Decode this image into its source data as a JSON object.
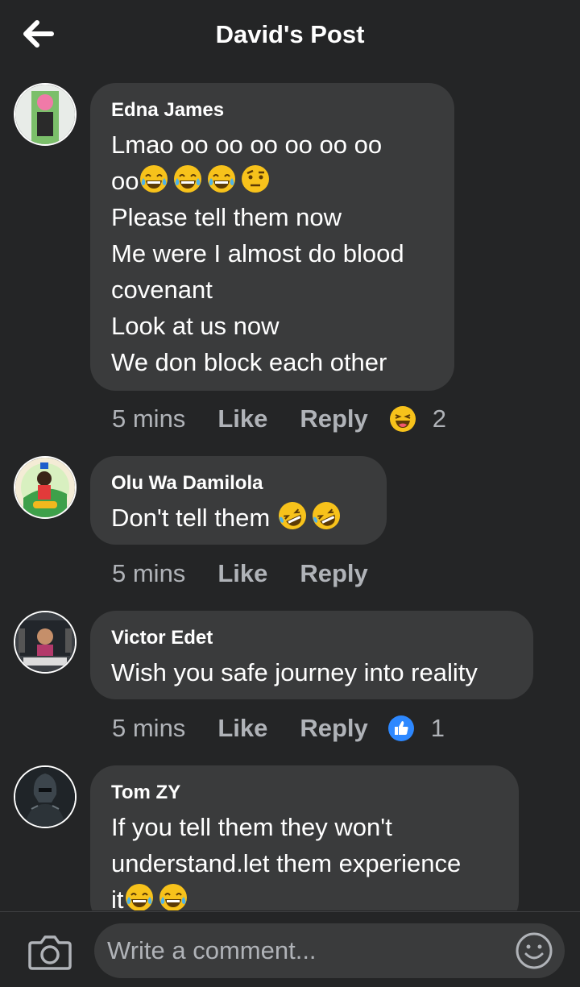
{
  "header": {
    "title": "David's Post",
    "back_icon": "arrow-left-icon"
  },
  "comments": [
    {
      "author": "Edna James",
      "lines": [
        "Lmao oo oo oo oo oo oo",
        "oo",
        "Please tell them now",
        "Me were I almost do blood",
        "covenant",
        "Look at us now",
        "We don block each other"
      ],
      "time": "5 mins",
      "like": "Like",
      "reply": "Reply",
      "reaction": "haha",
      "reaction_count": "2"
    },
    {
      "author": "Olu Wa Damilola",
      "lines": [
        "Don't tell them"
      ],
      "time": "5 mins",
      "like": "Like",
      "reply": "Reply"
    },
    {
      "author": "Victor Edet",
      "lines": [
        "Wish you safe journey into reality"
      ],
      "time": "5 mins",
      "like": "Like",
      "reply": "Reply",
      "reaction": "like",
      "reaction_count": "1"
    },
    {
      "author": "Tom ZY",
      "lines": [
        "If you tell them they won't",
        "understand.let them experience",
        "it"
      ]
    }
  ],
  "composer": {
    "placeholder": "Write a comment...",
    "camera_icon": "camera-icon",
    "emoji_icon": "smiley-icon"
  },
  "colors": {
    "background": "#242526",
    "bubble": "#3a3b3c",
    "muted": "#b0b3b8",
    "like_blue": "#2d88ff"
  }
}
